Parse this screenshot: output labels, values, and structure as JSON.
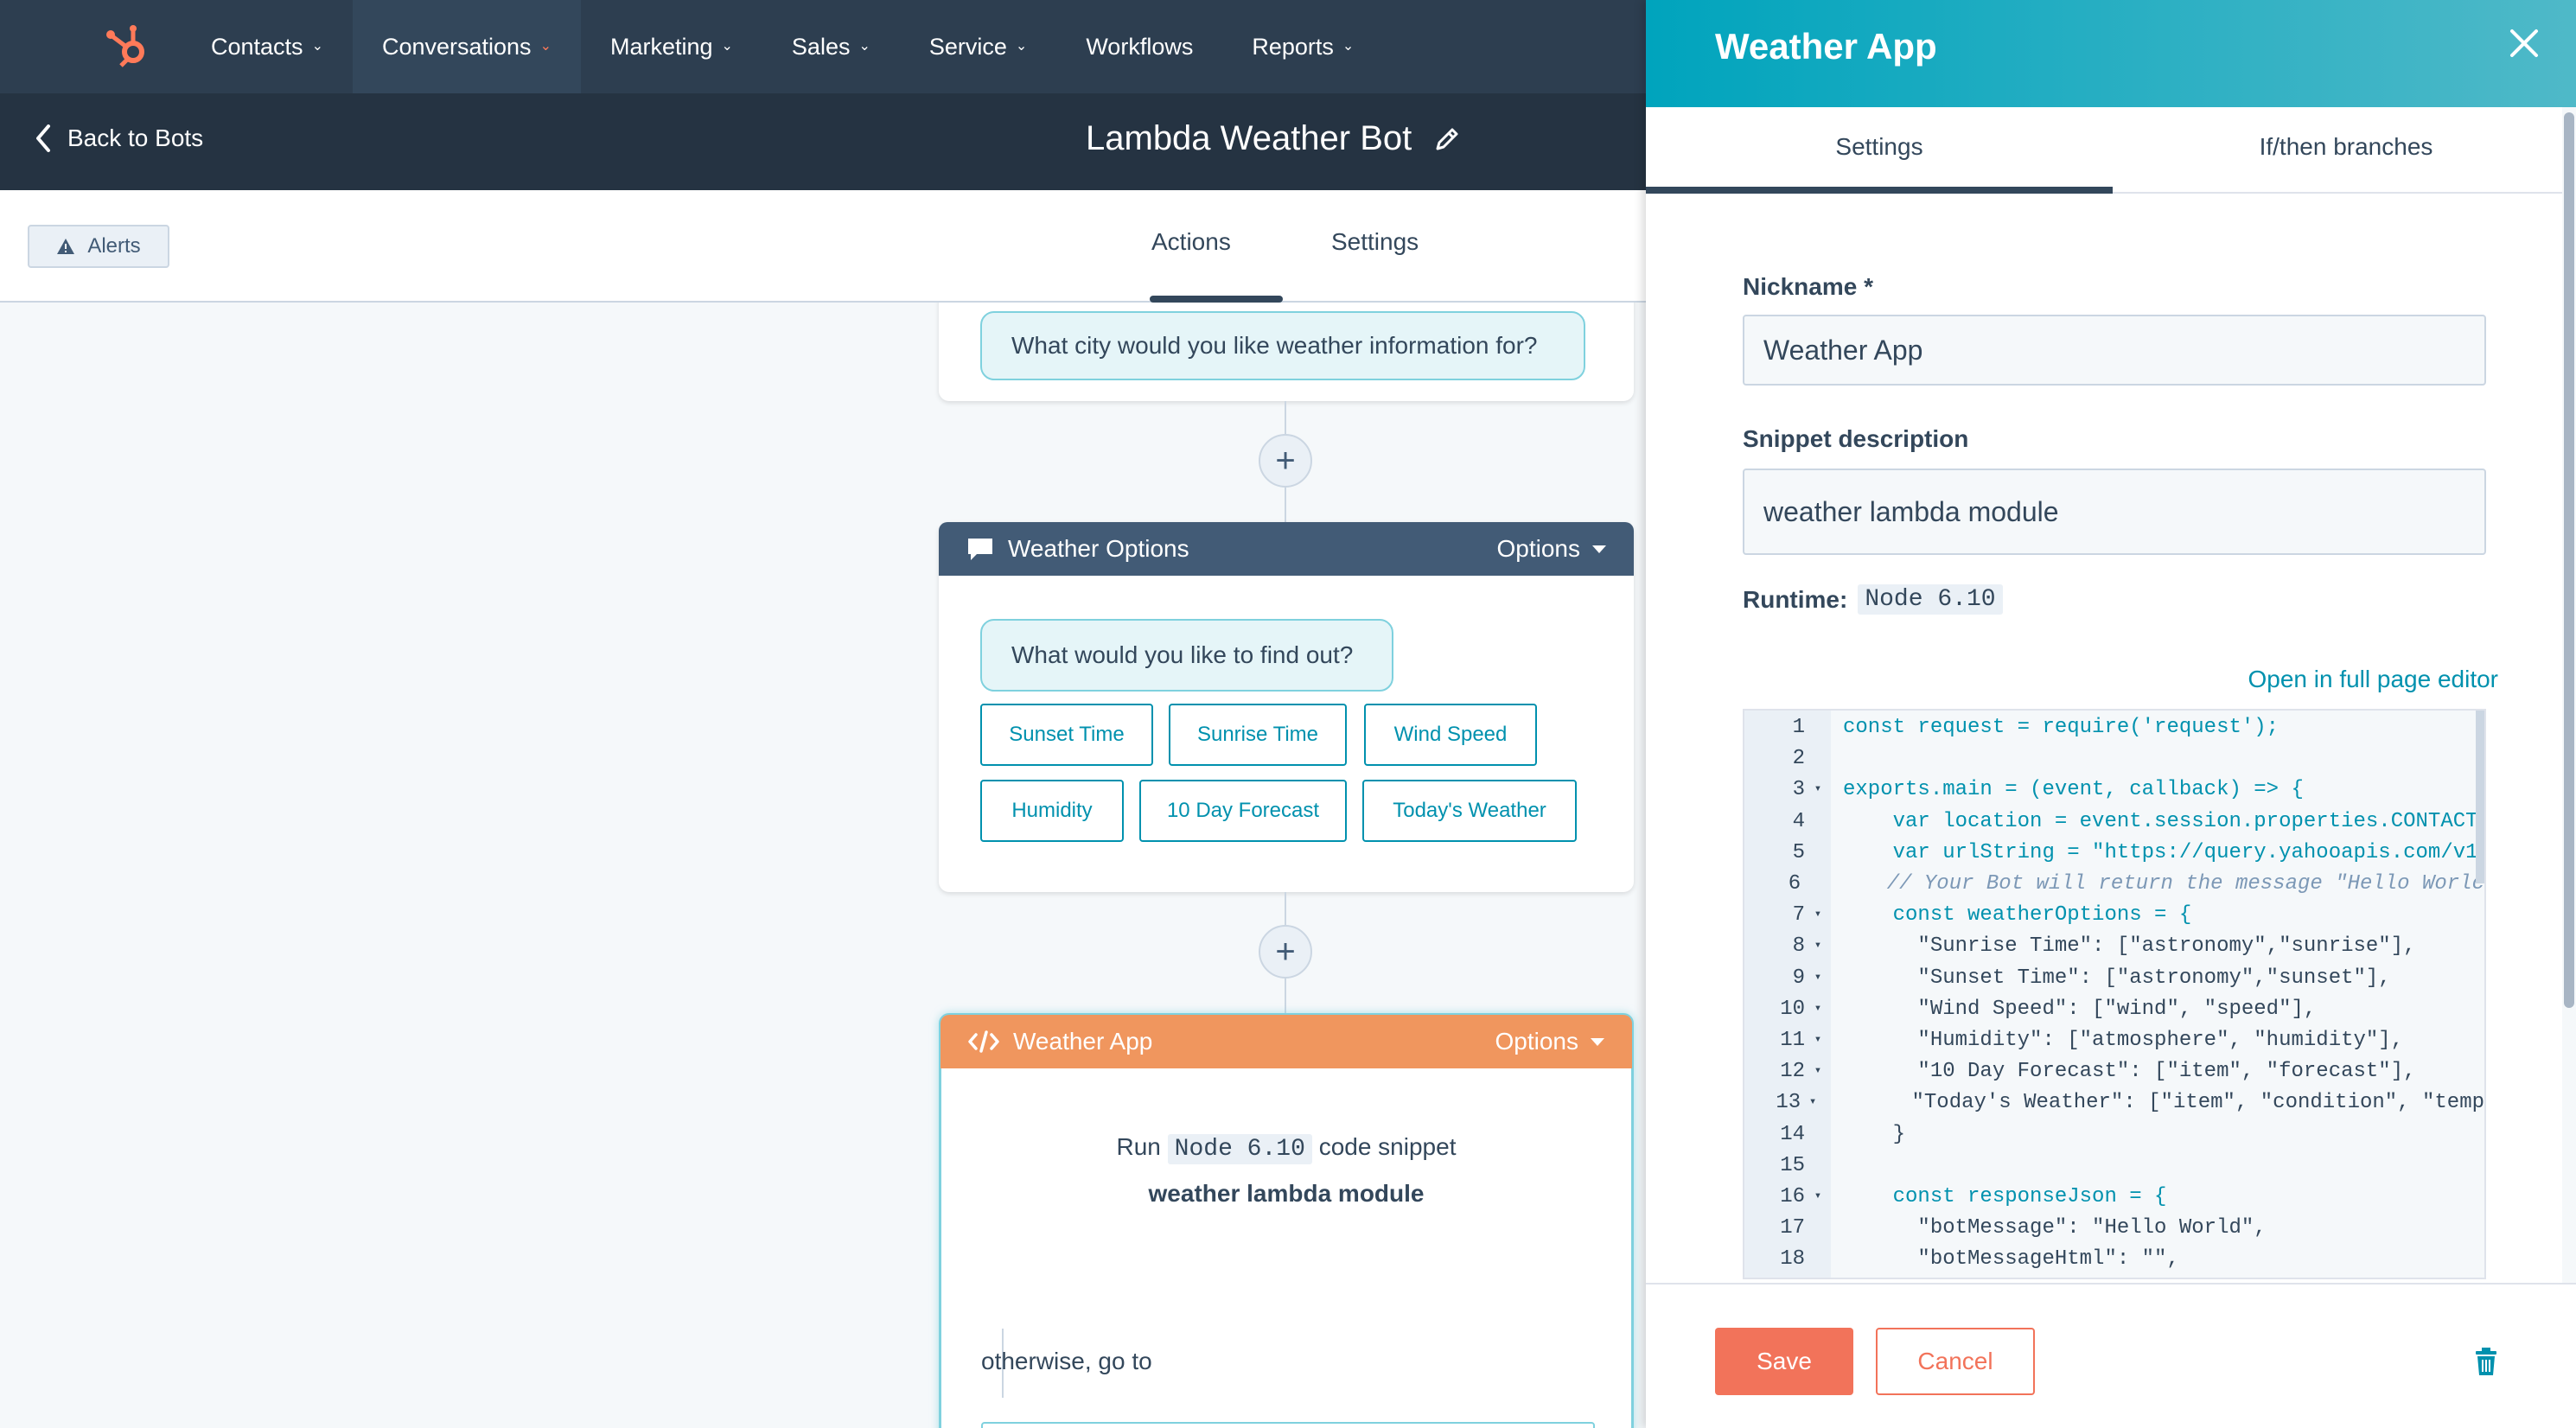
{
  "nav": {
    "items": [
      {
        "label": "Contacts",
        "dropdown": true
      },
      {
        "label": "Conversations",
        "dropdown": true,
        "active": true
      },
      {
        "label": "Marketing",
        "dropdown": true
      },
      {
        "label": "Sales",
        "dropdown": true
      },
      {
        "label": "Service",
        "dropdown": true
      },
      {
        "label": "Workflows",
        "dropdown": false
      },
      {
        "label": "Reports",
        "dropdown": true
      }
    ]
  },
  "subheader": {
    "back_label": "Back to Bots",
    "bot_title": "Lambda Weather Bot"
  },
  "tabbar": {
    "alerts_label": "Alerts",
    "tabs": [
      "Actions",
      "Settings"
    ],
    "active_tab": "Actions"
  },
  "canvas": {
    "top_card_question": "What city would you like weather information for?",
    "weather_options": {
      "title": "Weather Options",
      "options_label": "Options",
      "question": "What would you like to find out?",
      "buttons": [
        "Sunset Time",
        "Sunrise Time",
        "Wind Speed",
        "Humidity",
        "10 Day Forecast",
        "Today's Weather"
      ]
    },
    "weather_app": {
      "title": "Weather App",
      "options_label": "Options",
      "run_prefix": "Run",
      "runtime": "Node 6.10",
      "run_suffix": "code snippet",
      "module": "weather lambda module",
      "otherwise": "otherwise, go to"
    }
  },
  "panel": {
    "title": "Weather App",
    "tabs": [
      "Settings",
      "If/then branches"
    ],
    "active_tab": "Settings",
    "nickname_label": "Nickname *",
    "nickname_value": "Weather App",
    "description_label": "Snippet description",
    "description_value": "weather lambda module",
    "runtime_label": "Runtime:",
    "runtime_value": "Node 6.10",
    "open_full_label": "Open in full page editor",
    "code_lines": [
      {
        "n": "1",
        "fold": false
      },
      {
        "n": "2",
        "fold": false
      },
      {
        "n": "3",
        "fold": true
      },
      {
        "n": "4",
        "fold": false
      },
      {
        "n": "5",
        "fold": false
      },
      {
        "n": "6",
        "fold": false
      },
      {
        "n": "7",
        "fold": true
      },
      {
        "n": "8",
        "fold": true
      },
      {
        "n": "9",
        "fold": true
      },
      {
        "n": "10",
        "fold": true
      },
      {
        "n": "11",
        "fold": true
      },
      {
        "n": "12",
        "fold": true
      },
      {
        "n": "13",
        "fold": true
      },
      {
        "n": "14",
        "fold": false
      },
      {
        "n": "15",
        "fold": false
      },
      {
        "n": "16",
        "fold": true
      },
      {
        "n": "17",
        "fold": false
      },
      {
        "n": "18",
        "fold": false
      }
    ],
    "code_text": [
      "const request = require('request');",
      "",
      "exports.main = (event, callback) => {",
      "    var location = event.session.properties.CONTACT",
      "    var urlString = \"https://query.yahooapis.com/v1",
      "    // Your Bot will return the message \"Hello Worlc",
      "    const weatherOptions = {",
      "      \"Sunrise Time\": [\"astronomy\",\"sunrise\"],",
      "      \"Sunset Time\": [\"astronomy\",\"sunset\"],",
      "      \"Wind Speed\": [\"wind\", \"speed\"],",
      "      \"Humidity\": [\"atmosphere\", \"humidity\"],",
      "      \"10 Day Forecast\": [\"item\", \"forecast\"],",
      "      \"Today's Weather\": [\"item\", \"condition\", \"temp",
      "    }",
      "",
      "    const responseJson = {",
      "      \"botMessage\": \"Hello World\",",
      "      \"botMessageHtml\": \"\","
    ],
    "save_label": "Save",
    "cancel_label": "Cancel"
  },
  "colors": {
    "nav_bg": "#2d3e50",
    "subheader_bg": "#253342",
    "accent_orange": "#ff7a59",
    "teal": "#00a4bd",
    "link": "#0091ae",
    "weather_app_header": "#f0965e"
  }
}
